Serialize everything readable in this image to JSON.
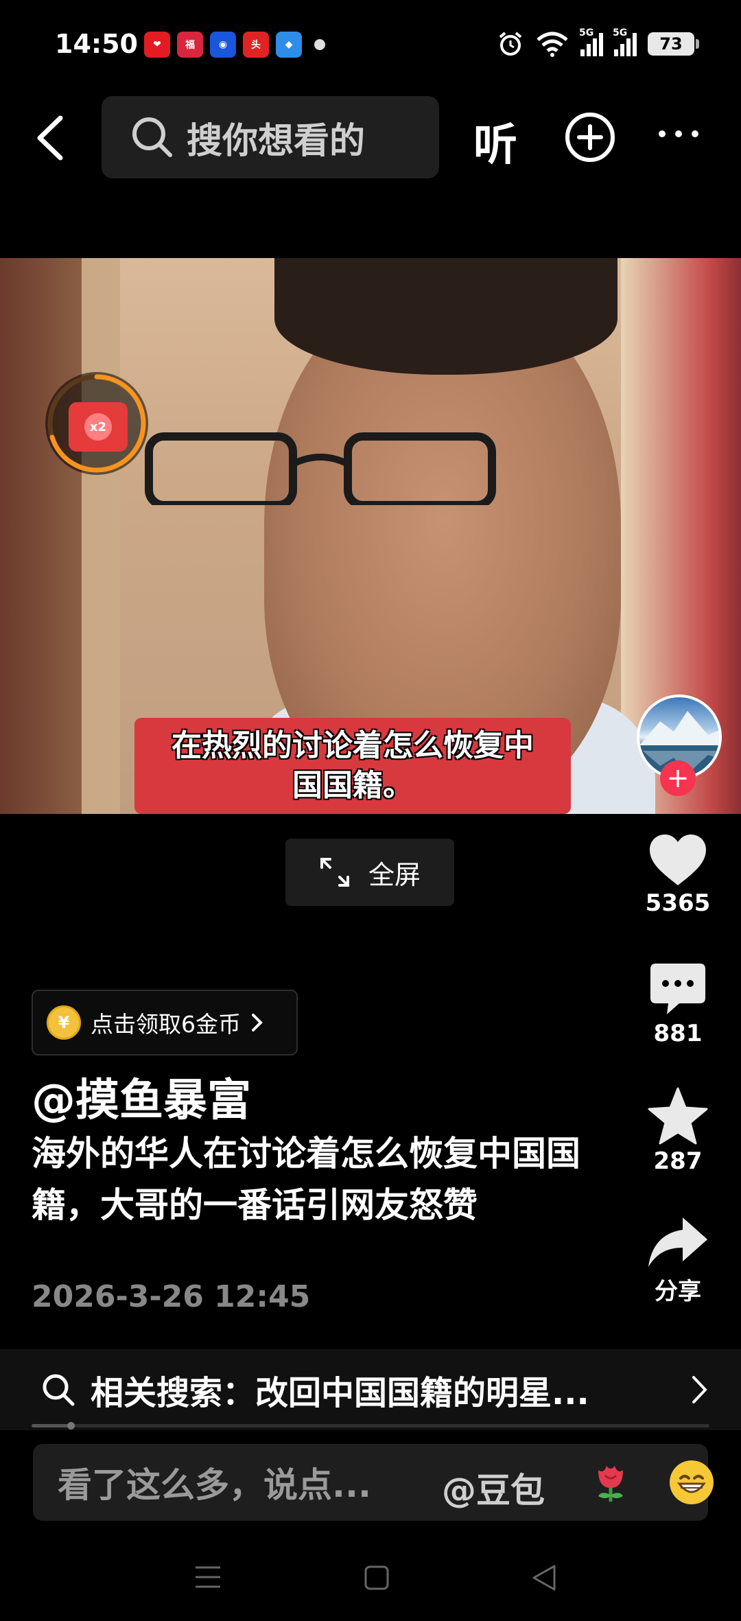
{
  "status_bar": {
    "time": "14:50",
    "battery": "73",
    "network_labels": [
      "5G",
      "5G"
    ]
  },
  "top_bar": {
    "search_placeholder": "搜你想看的",
    "listen_label": "听"
  },
  "video": {
    "caption": "在热烈的讨论着怎么恢复中国国籍。",
    "reward_multiplier": "x2"
  },
  "fullscreen": {
    "label": "全屏"
  },
  "actions": {
    "likes": "5365",
    "comments": "881",
    "favorites": "287",
    "share_label": "分享"
  },
  "coin_promo": {
    "label": "点击领取6金币",
    "coin_symbol": "¥"
  },
  "post": {
    "author": "@摸鱼暴富",
    "description": "海外的华人在讨论着怎么恢复中国国籍，大哥的一番话引网友怒赞",
    "datetime": "2026-3-26 12:45"
  },
  "related_search": {
    "text": "相关搜索：改回中国国籍的明星..."
  },
  "playback": {
    "progress_fraction": 0.058
  },
  "comment_box": {
    "placeholder": "看了这么多，说点...",
    "mention": "@豆包"
  },
  "colors": {
    "accent_red": "#f5344f",
    "reward_ring": "#f7941d",
    "coin_gold": "#f3c23c"
  },
  "icons": [
    "back-arrow-icon",
    "search-icon",
    "add-circle-icon",
    "more-icon",
    "heart-icon",
    "comment-icon",
    "star-icon",
    "share-icon",
    "expand-icon",
    "chevron-right-icon",
    "rose-emoji-icon",
    "grin-emoji-icon"
  ]
}
